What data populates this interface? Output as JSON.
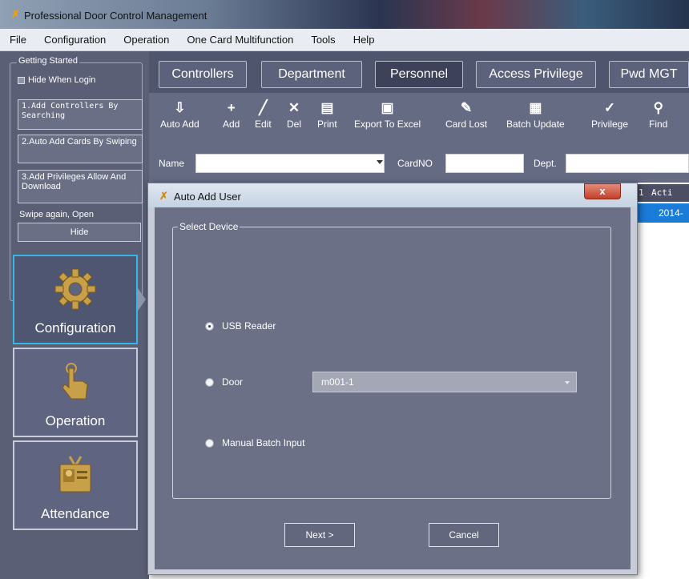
{
  "window": {
    "title": "Professional Door Control Management"
  },
  "menu": [
    "File",
    "Configuration",
    "Operation",
    "One Card Multifunction",
    "Tools",
    "Help"
  ],
  "getting_started": {
    "legend": "Getting Started",
    "hide_when_login": "Hide When Login",
    "step1": "1.Add Controllers By Searching",
    "step2": "2.Auto Add Cards By Swiping",
    "step3": "3.Add Privileges Allow And Download",
    "swipe_text": "Swipe again, Open",
    "hide_button": "Hide"
  },
  "nav": {
    "configuration": "Configuration",
    "operation": "Operation",
    "attendance": "Attendance"
  },
  "tabs": [
    "Controllers",
    "Department",
    "Personnel",
    "Access Privilege",
    "Pwd MGT"
  ],
  "active_tab": "Personnel",
  "toolbar": [
    {
      "label": "Auto Add",
      "icon": "auto-add-icon"
    },
    {
      "label": "Add",
      "icon": "add-icon"
    },
    {
      "label": "Edit",
      "icon": "edit-icon"
    },
    {
      "label": "Del",
      "icon": "delete-icon"
    },
    {
      "label": "Print",
      "icon": "print-icon"
    },
    {
      "label": "Export To Excel",
      "icon": "excel-icon"
    },
    {
      "label": "Card Lost",
      "icon": "card-lost-icon"
    },
    {
      "label": "Batch Update",
      "icon": "batch-update-icon"
    },
    {
      "label": "Privilege",
      "icon": "privilege-icon"
    },
    {
      "label": "Find",
      "icon": "find-icon"
    }
  ],
  "filter": {
    "name_label": "Name",
    "cardno_label": "CardNO",
    "dept_label": "Dept."
  },
  "grid": {
    "header_partial": "1",
    "header_active": "Acti",
    "row_value": "2014-"
  },
  "dialog": {
    "title": "Auto Add User",
    "close": "x",
    "group_legend": "Select Device",
    "options": {
      "usb": "USB Reader",
      "door": "Door",
      "manual": "Manual Batch Input"
    },
    "selected": "USB Reader",
    "door_value": "m001-1",
    "next": "Next >",
    "cancel": "Cancel"
  }
}
